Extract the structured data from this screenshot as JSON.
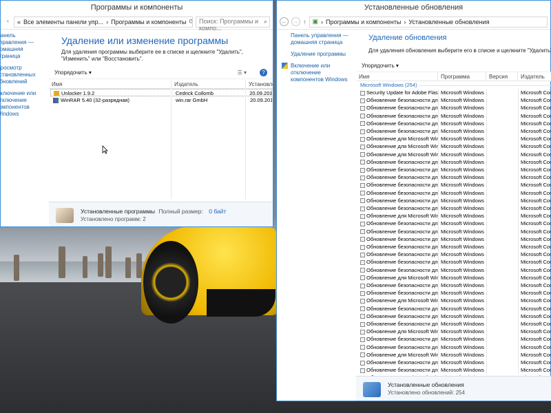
{
  "left_window": {
    "title": "Программы и компоненты",
    "breadcrumb": [
      "Все элементы панели упр...",
      "Программы и компоненты"
    ],
    "search_placeholder": "Поиск: Программы и компо...",
    "sidebar": [
      "Панель управления — домашняя страница",
      "Просмотр установленных обновлений",
      "Включение или отключение компонентов Windows"
    ],
    "heading": "Удаление или изменение программы",
    "description": "Для удаления программы выберите ее в списке и щелкните \"Удалить\", \"Изменить\" или \"Восстановить\".",
    "toolbar_label": "Упорядочить",
    "columns": [
      "Имя",
      "Издатель",
      "Установле..."
    ],
    "rows": [
      {
        "name": "Unlocker 1.9.2",
        "publisher": "Cedrick Collomb",
        "date": "20.09.2016"
      },
      {
        "name": "WinRAR 5.40 (32-разрядная)",
        "publisher": "win.rar GmbH",
        "date": "20.09.2016"
      }
    ],
    "status_title": "Установленные программы",
    "status_size_label": "Полный размер:",
    "status_size_value": "0 байт",
    "status_count": "Установлено программ: 2"
  },
  "right_window": {
    "title": "Установленные обновления",
    "breadcrumb": [
      "Программы и компоненты",
      "Установленные обновления"
    ],
    "sidebar": [
      "Панель управления — домашняя страница",
      "Удаление программы",
      "Включение или отключение компонентов Windows"
    ],
    "heading": "Удаление обновления",
    "description": "Для удаления обновления выберите его в списке и щелкните \"Удалить\" или \"",
    "toolbar_label": "Упорядочить",
    "columns": [
      "Имя",
      "Программа",
      "Версия",
      "Издатель"
    ],
    "group": "Microsoft Windows (254)",
    "rows": [
      "Security Update for Adobe Flash ...",
      "Обновление безопасности для ...",
      "Обновление безопасности для ...",
      "Обновление безопасности для ...",
      "Обновление безопасности для ...",
      "Обновление безопасности для ...",
      "Обновление для Microsoft Win...",
      "Обновление для Microsoft Win...",
      "Обновление для Microsoft Win...",
      "Обновление безопасности для ...",
      "Обновление безопасности для ...",
      "Обновление безопасности для ...",
      "Обновление безопасности для ...",
      "Обновление безопасности для ...",
      "Обновление безопасности для ...",
      "Обновление безопасности для ...",
      "Обновление для Microsoft Win...",
      "Обновление безопасности для ...",
      "Обновление безопасности для ...",
      "Обновление безопасности для ...",
      "Обновление безопасности для ...",
      "Обновление безопасности для ...",
      "Обновление безопасности для ...",
      "Обновление безопасности для ...",
      "Обновление для Microsoft Win...",
      "Обновление безопасности для ...",
      "Обновление безопасности для ...",
      "Обновление для Microsoft Win...",
      "Обновление безопасности для ...",
      "Обновление безопасности для ...",
      "Обновление безопасности для ...",
      "Обновление для Microsoft Win...",
      "Обновление безопасности для ...",
      "Обновление безопасности для ...",
      "Обновление для Microsoft Win...",
      "Обновление безопасности для ...",
      "Обновление безопасности для ...",
      "Обновление для Microsoft Win...",
      "Обновление для Microsoft Win...",
      "Обновление безопасности для ..."
    ],
    "row_program": "Microsoft Windows",
    "row_publisher": "Microsoft Corpo",
    "status_title": "Установленные обновления",
    "status_count": "Установлено обновлений: 254"
  },
  "colors": {
    "accent": "#1e66b8",
    "close": "#c9302c",
    "status_bg": "#f3f6fa"
  }
}
